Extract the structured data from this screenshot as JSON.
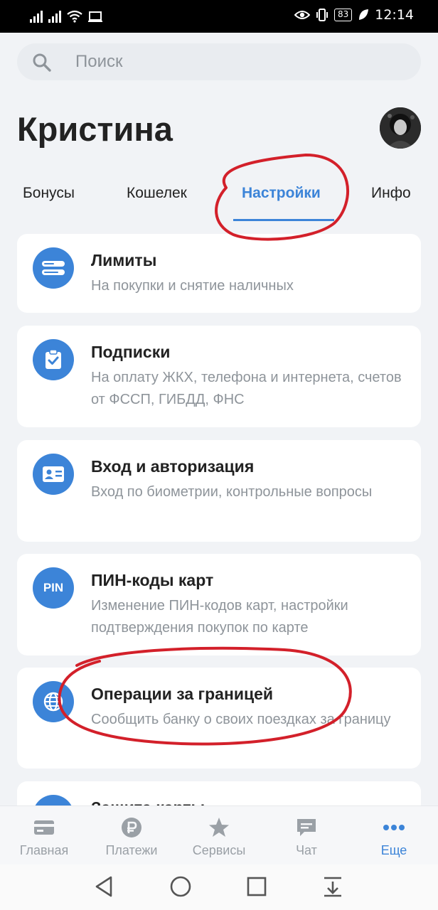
{
  "status_bar": {
    "battery": "83",
    "time": "12:14"
  },
  "search": {
    "placeholder": "Поиск"
  },
  "header": {
    "title": "Кристина"
  },
  "tabs": [
    {
      "label": "Бонусы"
    },
    {
      "label": "Кошелек"
    },
    {
      "label": "Настройки",
      "active": true
    },
    {
      "label": "Инфо"
    }
  ],
  "cards": [
    {
      "title": "Лимиты",
      "subtitle": "На покупки и снятие наличных",
      "icon": "limits-icon"
    },
    {
      "title": "Подписки",
      "subtitle": "На оплату ЖКХ, телефона и интернета, счетов от ФССП, ГИБДД, ФНС",
      "icon": "clipboard-check-icon"
    },
    {
      "title": "Вход и авторизация",
      "subtitle": "Вход по биометрии, контрольные вопросы",
      "icon": "id-card-icon"
    },
    {
      "title": "ПИН-коды карт",
      "subtitle": "Изменение ПИН-кодов карт, настройки подтверждения покупок по карте",
      "icon_text": "PIN"
    },
    {
      "title": "Операции за границей",
      "subtitle": "Сообщить банку о своих поездках за границу",
      "icon": "globe-icon"
    },
    {
      "title": "Защита карты",
      "subtitle": "",
      "icon": "shield-icon"
    }
  ],
  "bottom_nav": [
    {
      "label": "Главная",
      "icon": "card-icon"
    },
    {
      "label": "Платежи",
      "icon": "ruble-icon"
    },
    {
      "label": "Сервисы",
      "icon": "star-icon"
    },
    {
      "label": "Чат",
      "icon": "chat-icon"
    },
    {
      "label": "Еще",
      "icon": "more-dots-icon",
      "active": true
    }
  ],
  "colors": {
    "accent": "#3c84d8",
    "annotation": "#d3202a",
    "background": "#f1f3f6"
  }
}
